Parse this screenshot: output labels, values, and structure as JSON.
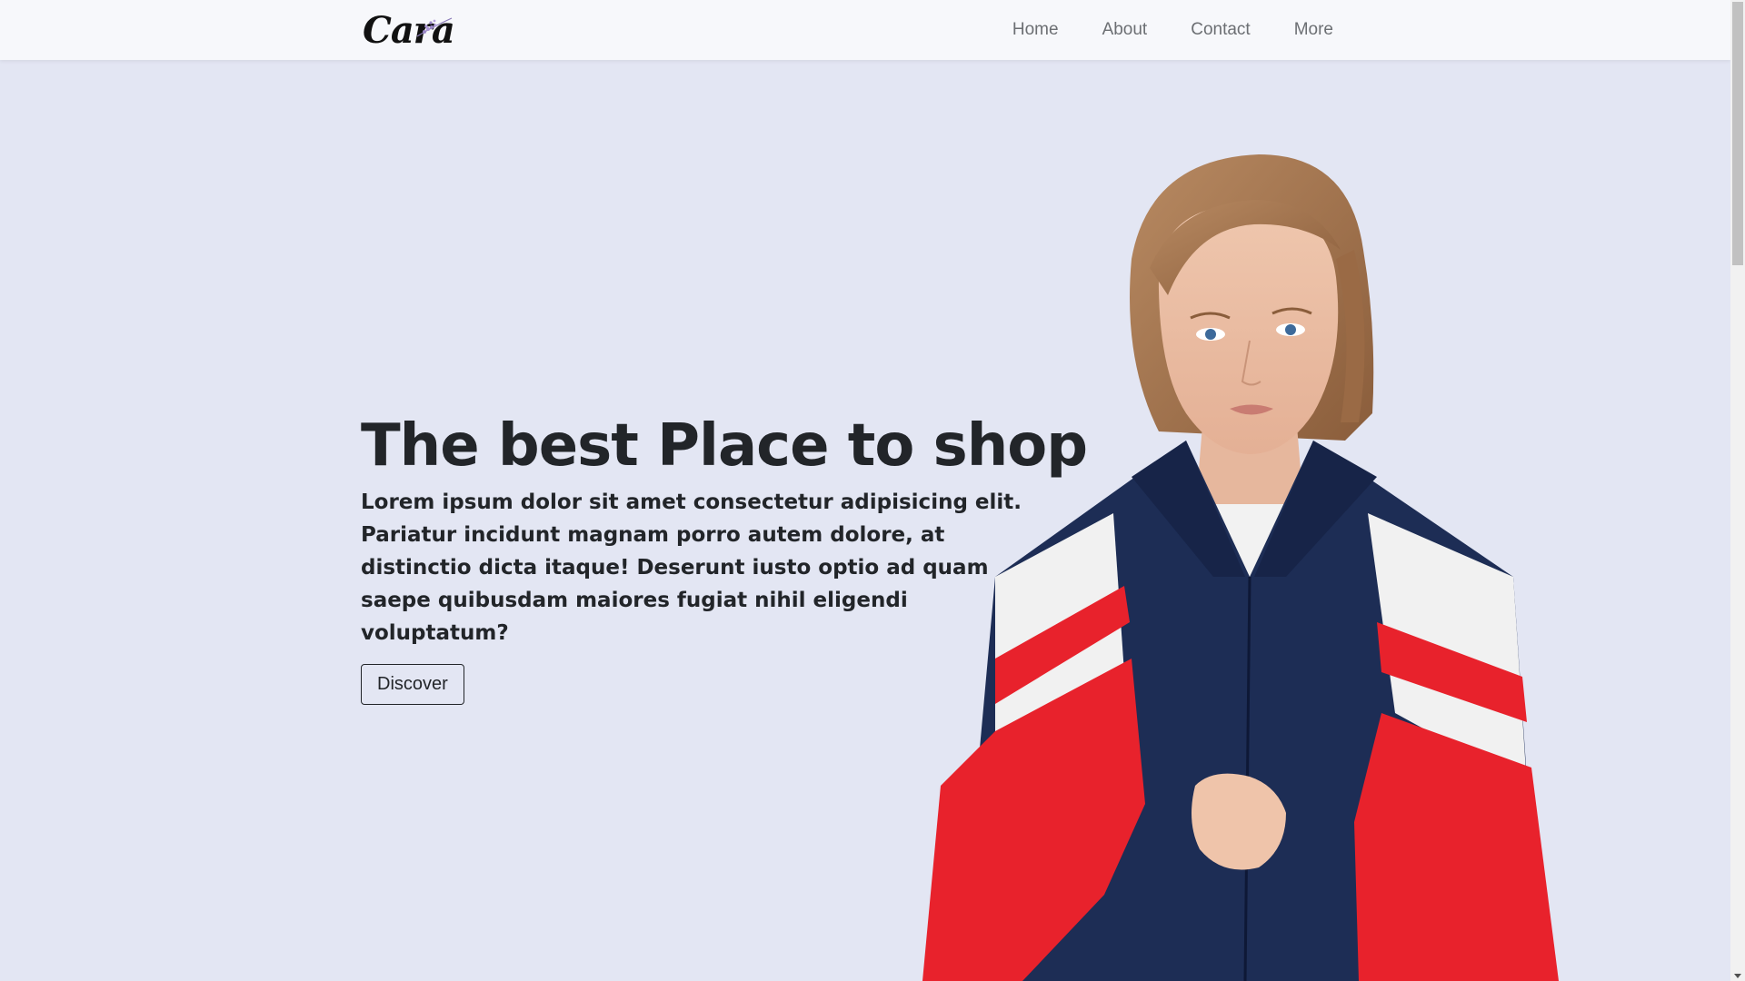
{
  "brand": {
    "logo_text": "Cara"
  },
  "nav": {
    "items": [
      {
        "label": "Home"
      },
      {
        "label": "About"
      },
      {
        "label": "Contact"
      },
      {
        "label": "More"
      }
    ]
  },
  "hero": {
    "title": "The best Place to shop",
    "description": "Lorem ipsum dolor sit amet consectetur adipisicing elit. Pariatur incidunt magnam porro autem dolore, at distinctio dicta itaque! Deserunt iusto optio ad quam saepe quibusdam maiores fugiat nihil eligendi voluptatum?",
    "button_label": "Discover"
  },
  "colors": {
    "background": "#e3e6f3",
    "navbar": "#f7f8fb",
    "text_dark": "#222529",
    "jacket_red": "#e8222c",
    "jacket_navy": "#1d2d55"
  }
}
